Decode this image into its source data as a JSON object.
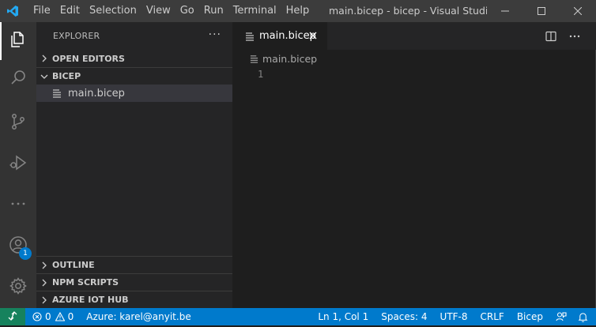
{
  "titlebar": {
    "menu": [
      "File",
      "Edit",
      "Selection",
      "View",
      "Go",
      "Run",
      "Terminal",
      "Help"
    ],
    "title": "main.bicep - bicep - Visual Studio C..."
  },
  "activitybar": {
    "items": [
      "explorer",
      "search",
      "source-control",
      "run-debug",
      "more",
      "accounts",
      "manage"
    ],
    "accounts_badge": "1"
  },
  "sidebar": {
    "header": "EXPLORER",
    "more": "···",
    "sections": {
      "open_editors": "OPEN EDITORS",
      "folder": "BICEP",
      "outline": "OUTLINE",
      "npm_scripts": "NPM SCRIPTS",
      "azure_iot_hub": "AZURE IOT HUB"
    },
    "files": [
      {
        "name": "main.bicep"
      }
    ]
  },
  "editor": {
    "tab_label": "main.bicep",
    "breadcrumb": "main.bicep",
    "line_numbers": [
      "1"
    ]
  },
  "statusbar": {
    "errors": "0",
    "warnings": "0",
    "account": "Azure: karel@anyit.be",
    "cursor": "Ln 1, Col 1",
    "spaces": "Spaces: 4",
    "encoding": "UTF-8",
    "eol": "CRLF",
    "language": "Bicep"
  },
  "colors": {
    "accent": "#007acc",
    "remote": "#16825d",
    "titlebar": "#3c3c3c",
    "activitybar": "#333333",
    "sidebar": "#252526",
    "editor": "#1e1e1e"
  }
}
